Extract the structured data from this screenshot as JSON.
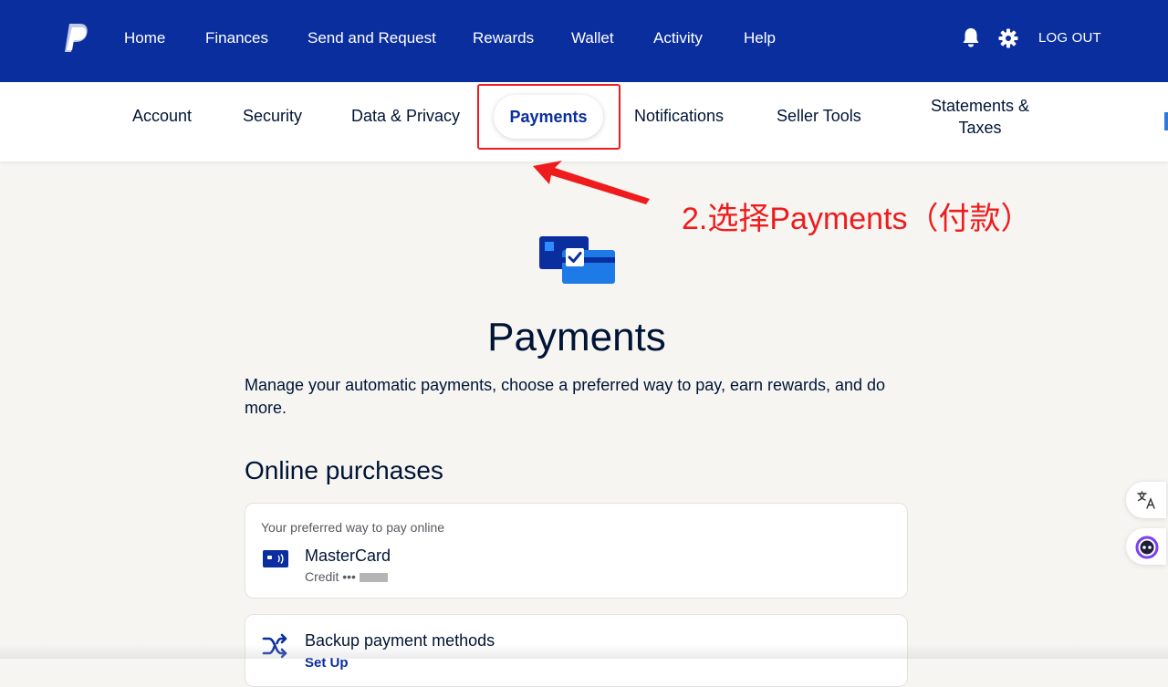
{
  "topbar": {
    "logo": "paypal-logo",
    "nav": [
      "Home",
      "Finances",
      "Send and Request",
      "Rewards",
      "Wallet",
      "Activity",
      "Help"
    ],
    "icons": [
      "bell-icon",
      "gear-icon"
    ],
    "logout_label": "LOG OUT",
    "bg_color": "#0a2e9e"
  },
  "subnav": {
    "items": [
      "Account",
      "Security",
      "Data & Privacy",
      "Payments",
      "Notifications",
      "Seller Tools"
    ],
    "multiline_item": [
      "Statements &",
      "Taxes"
    ],
    "active_item": "Payments"
  },
  "annotation": {
    "text": "2.选择Payments（付款）",
    "color": "#ee1c1c"
  },
  "main": {
    "hero_icon": "cards-check-icon",
    "title": "Payments",
    "description": "Manage your automatic payments, choose a preferred way to pay, earn rewards, and do more.",
    "section_title": "Online purchases",
    "preferred_card": {
      "label": "Your preferred way to pay online",
      "icon": "card-icon",
      "name": "MasterCard",
      "detail": "Credit •••"
    },
    "backup_card": {
      "icon": "shuffle-icon",
      "title": "Backup payment methods",
      "link": "Set Up"
    }
  },
  "floating": {
    "translate_icon": "translate-icon",
    "assistant_icon": "assistant-icon"
  }
}
